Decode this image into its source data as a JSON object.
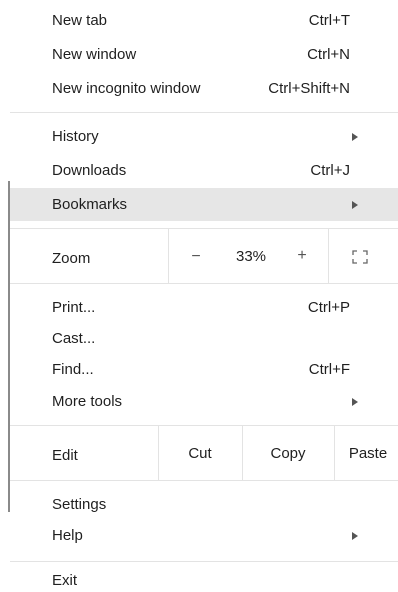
{
  "menu": {
    "new_tab": {
      "label": "New tab",
      "shortcut": "Ctrl+T"
    },
    "new_window": {
      "label": "New window",
      "shortcut": "Ctrl+N"
    },
    "new_incognito": {
      "label": "New incognito window",
      "shortcut": "Ctrl+Shift+N"
    },
    "history": {
      "label": "History"
    },
    "downloads": {
      "label": "Downloads",
      "shortcut": "Ctrl+J"
    },
    "bookmarks": {
      "label": "Bookmarks"
    },
    "zoom": {
      "label": "Zoom",
      "minus": "−",
      "value": "33%",
      "plus": "+",
      "fullscreen_icon": "fullscreen-icon"
    },
    "print": {
      "label": "Print...",
      "shortcut": "Ctrl+P"
    },
    "cast": {
      "label": "Cast..."
    },
    "find": {
      "label": "Find...",
      "shortcut": "Ctrl+F"
    },
    "more_tools": {
      "label": "More tools"
    },
    "edit": {
      "label": "Edit",
      "cut": "Cut",
      "copy": "Copy",
      "paste": "Paste"
    },
    "settings": {
      "label": "Settings"
    },
    "help": {
      "label": "Help"
    },
    "exit": {
      "label": "Exit"
    }
  },
  "colors": {
    "highlight": "#e6e6e6",
    "separator": "#e3e3e3",
    "text": "#1f1f1f"
  }
}
